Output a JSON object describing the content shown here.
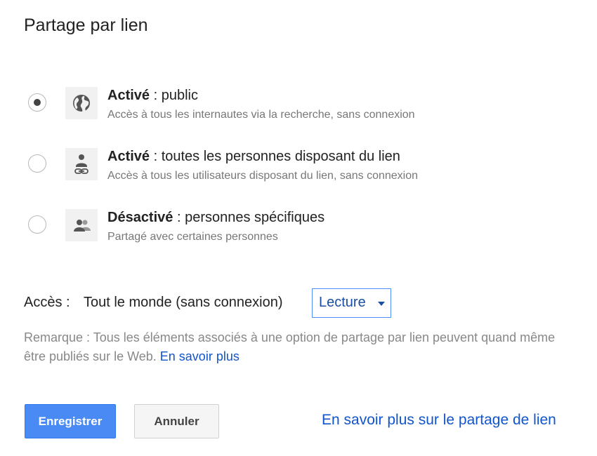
{
  "dialog": {
    "title": "Partage par lien"
  },
  "options": [
    {
      "title_bold": "Activé",
      "title_rest": " : public",
      "description": "Accès à tous les internautes via la recherche, sans connexion",
      "icon": "globe-icon",
      "selected": true
    },
    {
      "title_bold": "Activé",
      "title_rest": " : toutes les personnes disposant du lien",
      "description": "Accès à tous les utilisateurs disposant du lien, sans connexion",
      "icon": "person-link-icon",
      "selected": false
    },
    {
      "title_bold": "Désactivé",
      "title_rest": " : personnes spécifiques",
      "description": "Partagé avec certaines personnes",
      "icon": "people-icon",
      "selected": false
    }
  ],
  "access": {
    "label": "Accès :",
    "value": "Tout le monde (sans connexion)",
    "dropdown_value": "Lecture"
  },
  "note": {
    "text": "Remarque : Tous les éléments associés à une option de partage par lien peuvent quand même être publiés sur le Web.",
    "link": "En savoir plus"
  },
  "buttons": {
    "save": "Enregistrer",
    "cancel": "Annuler",
    "learn_more": "En savoir plus sur le partage de lien"
  },
  "colors": {
    "primary_button": "#4a8af4",
    "link": "#1155cc",
    "focus_border": "#4d90fe"
  }
}
